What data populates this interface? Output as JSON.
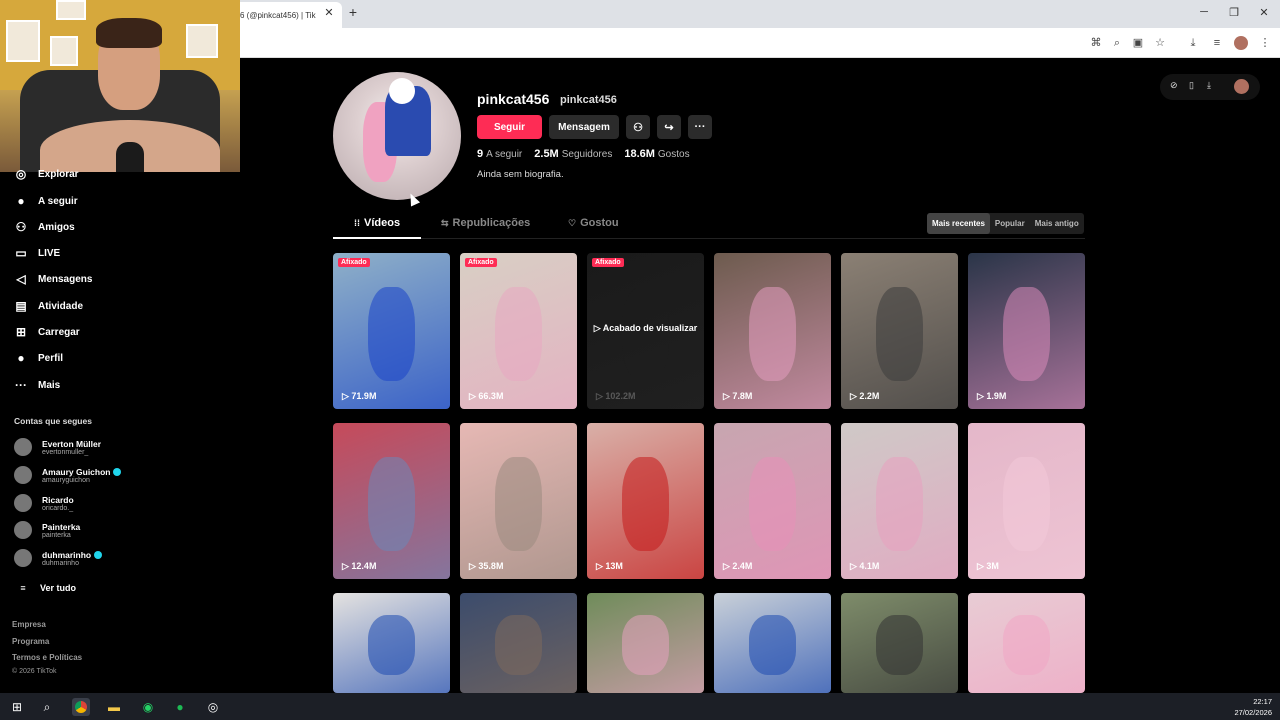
{
  "browser": {
    "tab_title": "6 (@pinkcat456) | Tik",
    "tab_close": "✕",
    "new_tab": "+"
  },
  "sidebar": {
    "items": [
      {
        "label": "Explorar",
        "icon": "compass-icon",
        "glyph": "◎"
      },
      {
        "label": "A seguir",
        "icon": "following-avatar-icon",
        "glyph": "●"
      },
      {
        "label": "Amigos",
        "icon": "friends-icon",
        "glyph": "⚇"
      },
      {
        "label": "LIVE",
        "icon": "live-icon",
        "glyph": "▭"
      },
      {
        "label": "Mensagens",
        "icon": "messages-icon",
        "glyph": "◁"
      },
      {
        "label": "Atividade",
        "icon": "activity-icon",
        "glyph": "▤"
      },
      {
        "label": "Carregar",
        "icon": "upload-icon",
        "glyph": "⊞"
      },
      {
        "label": "Perfil",
        "icon": "profile-avatar-icon",
        "glyph": "●"
      },
      {
        "label": "Mais",
        "icon": "more-icon",
        "glyph": "···"
      }
    ],
    "following_header": "Contas que segues",
    "accounts": [
      {
        "name": "Everton Müller",
        "username": "evertonmuller_",
        "verified": false
      },
      {
        "name": "Amaury Guichon",
        "username": "amauryguichon",
        "verified": true
      },
      {
        "name": "Ricardo",
        "username": "oricardo._",
        "verified": false
      },
      {
        "name": "Painterka",
        "username": "painterka",
        "verified": false
      },
      {
        "name": "duhmarinho",
        "username": "duhmarinho",
        "verified": true
      }
    ],
    "see_all": "Ver tudo",
    "footer": [
      "Empresa",
      "Programa",
      "Termos e Políticas",
      "© 2026 TikTok"
    ]
  },
  "profile": {
    "display_name": "pinkcat456",
    "handle": "pinkcat456",
    "follow_label": "Seguir",
    "message_label": "Mensagem",
    "following_count": "9",
    "following_label": "A seguir",
    "followers_count": "2.5M",
    "followers_label": "Seguidores",
    "likes_count": "18.6M",
    "likes_label": "Gostos",
    "bio": "Ainda sem biografia."
  },
  "tabs": {
    "videos": "Vídeos",
    "reposts": "Republicações",
    "liked": "Gostou"
  },
  "sort": {
    "recent": "Mais recentes",
    "popular": "Popular",
    "oldest": "Mais antigo"
  },
  "videos": [
    {
      "views": "71.9M",
      "pinned": true,
      "watched": false,
      "bg": "#8fb0c8",
      "accent": "#1a44c8"
    },
    {
      "views": "66.3M",
      "pinned": true,
      "watched": false,
      "bg": "#d8cfc4",
      "accent": "#e8a7c1"
    },
    {
      "views": "102.2M",
      "pinned": true,
      "watched": true,
      "bg": "#1a1a1a",
      "accent": "#222222"
    },
    {
      "views": "7.8M",
      "pinned": false,
      "watched": false,
      "bg": "#6d5b4e",
      "accent": "#e39cc0"
    },
    {
      "views": "2.2M",
      "pinned": false,
      "watched": false,
      "bg": "#8b8074",
      "accent": "#3c3c3c"
    },
    {
      "views": "1.9M",
      "pinned": false,
      "watched": false,
      "bg": "#2a3548",
      "accent": "#d98ab9"
    },
    {
      "views": "12.4M",
      "pinned": false,
      "watched": false,
      "bg": "#c64a5a",
      "accent": "#6b86b8"
    },
    {
      "views": "35.8M",
      "pinned": false,
      "watched": false,
      "bg": "#e6b8b4",
      "accent": "#9a8a80"
    },
    {
      "views": "13M",
      "pinned": false,
      "watched": false,
      "bg": "#d9b0a8",
      "accent": "#c41a1a"
    },
    {
      "views": "2.4M",
      "pinned": false,
      "watched": false,
      "bg": "#c7a6b0",
      "accent": "#e88fb8"
    },
    {
      "views": "4.1M",
      "pinned": false,
      "watched": false,
      "bg": "#cfc9c7",
      "accent": "#e7a0c0"
    },
    {
      "views": "3M",
      "pinned": false,
      "watched": false,
      "bg": "#e4b7c9",
      "accent": "#f2c9d8"
    },
    {
      "views": "",
      "pinned": false,
      "watched": false,
      "bg": "#e4e2e0",
      "accent": "#1e4bb0"
    },
    {
      "views": "",
      "pinned": false,
      "watched": false,
      "bg": "#3c4c6c",
      "accent": "#7e6a5c"
    },
    {
      "views": "",
      "pinned": false,
      "watched": false,
      "bg": "#6f8c5a",
      "accent": "#e5a2c0"
    },
    {
      "views": "",
      "pinned": false,
      "watched": false,
      "bg": "#c9d0d8",
      "accent": "#1e4bb0"
    },
    {
      "views": "",
      "pinned": false,
      "watched": false,
      "bg": "#7e8c6a",
      "accent": "#333333"
    },
    {
      "views": "",
      "pinned": false,
      "watched": false,
      "bg": "#e8ccd4",
      "accent": "#f0a6c4"
    }
  ],
  "pinned_label": "Afixado",
  "watched_label": "▷ Acabado de visualizar",
  "clock": {
    "time": "22:17",
    "date": "27/02/2026"
  },
  "colors": {
    "brand": "#fe2c55",
    "verified": "#20d5ec"
  }
}
